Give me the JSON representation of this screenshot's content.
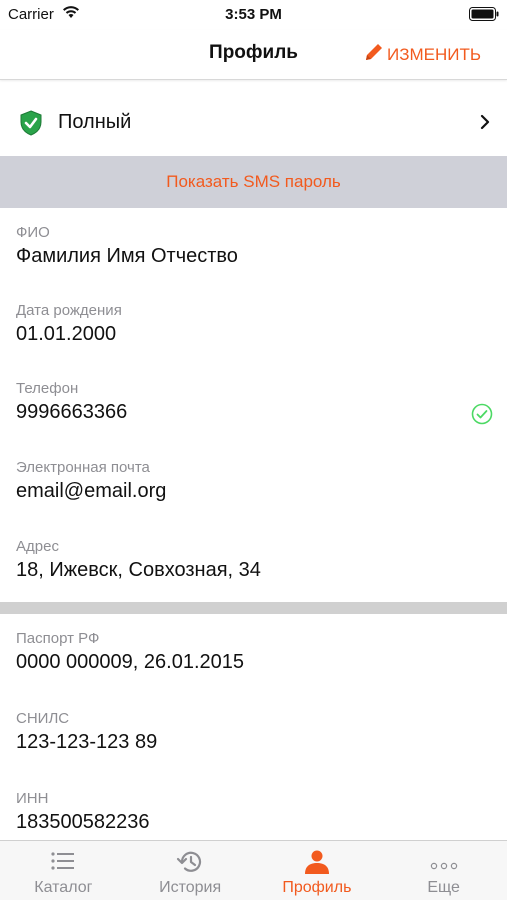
{
  "status_bar": {
    "carrier": "Carrier",
    "time": "3:53 PM"
  },
  "nav": {
    "title": "Профиль",
    "edit_label": "ИЗМЕНИТЬ"
  },
  "level": {
    "label": "Полный",
    "icon": "shield-check-icon"
  },
  "sms_button": "Показать SMS пароль",
  "fields": [
    {
      "label": "ФИО",
      "value": "Фамилия Имя Отчество"
    },
    {
      "label": "Дата рождения",
      "value": "01.01.2000"
    },
    {
      "label": "Телефон",
      "value": "9996663366",
      "verified": true
    },
    {
      "label": "Электронная почта",
      "value": "email@email.org"
    },
    {
      "label": "Адрес",
      "value": "18, Ижевск, Совхозная, 34"
    },
    {
      "label": "Паспорт РФ",
      "value": "0000 000009, 26.01.2015"
    },
    {
      "label": "СНИЛС",
      "value": "123-123-123 89"
    },
    {
      "label": "ИНН",
      "value": "183500582236"
    }
  ],
  "tabs": [
    {
      "label": "Каталог",
      "icon": "list-icon"
    },
    {
      "label": "История",
      "icon": "history-icon"
    },
    {
      "label": "Профиль",
      "icon": "person-icon",
      "active": true
    },
    {
      "label": "Еще",
      "icon": "more-icon"
    }
  ],
  "colors": {
    "accent": "#f25a1e",
    "verified": "#4cd964",
    "shield": "#2aa34a",
    "band": "#cfd0d8"
  }
}
